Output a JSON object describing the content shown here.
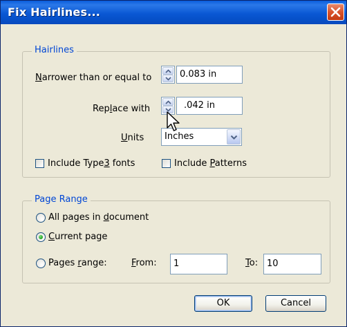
{
  "dialog": {
    "title": "Fix Hairlines..."
  },
  "hairlines": {
    "group_title": "Hairlines",
    "narrower_label_underlined": "N",
    "narrower_label_rest": "arrower than or equal to",
    "narrower_value": "0.083 in",
    "replace_label_pre": "Rep",
    "replace_label_underlined": "l",
    "replace_label_post": "ace with",
    "replace_value": ".042 in",
    "units_label_underlined": "U",
    "units_label_rest": "nits",
    "units_value": "Inches",
    "type3_label_pre": "Include Type",
    "type3_label_underlined": "3",
    "type3_label_post": " fonts",
    "type3_checked": false,
    "patterns_label_pre": "Include ",
    "patterns_label_underlined": "P",
    "patterns_label_post": "atterns",
    "patterns_checked": false
  },
  "page_range": {
    "group_title": "Page Range",
    "all_pages_pre": "All pages in ",
    "all_pages_underlined": "d",
    "all_pages_post": "ocument",
    "current_page_underlined": "C",
    "current_page_rest": "urrent page",
    "pages_range_pre": "Pages ",
    "pages_range_underlined": "r",
    "pages_range_post": "ange:",
    "from_label_underlined": "F",
    "from_label_rest": "rom:",
    "from_value": "1",
    "to_label_underlined": "T",
    "to_label_rest": "o:",
    "to_value": "10",
    "selected": "current_page"
  },
  "buttons": {
    "ok": "OK",
    "cancel": "Cancel"
  },
  "icons": {
    "close": "close-icon",
    "spin_up": "chevron-up-icon",
    "spin_down": "chevron-down-icon",
    "dropdown": "chevron-down-icon",
    "cursor": "mouse-pointer-icon"
  },
  "colors": {
    "titlebar": "#0a58d4",
    "group_title": "#0046d5",
    "dialog_bg": "#ece9d8",
    "close_button": "#d9532c"
  }
}
